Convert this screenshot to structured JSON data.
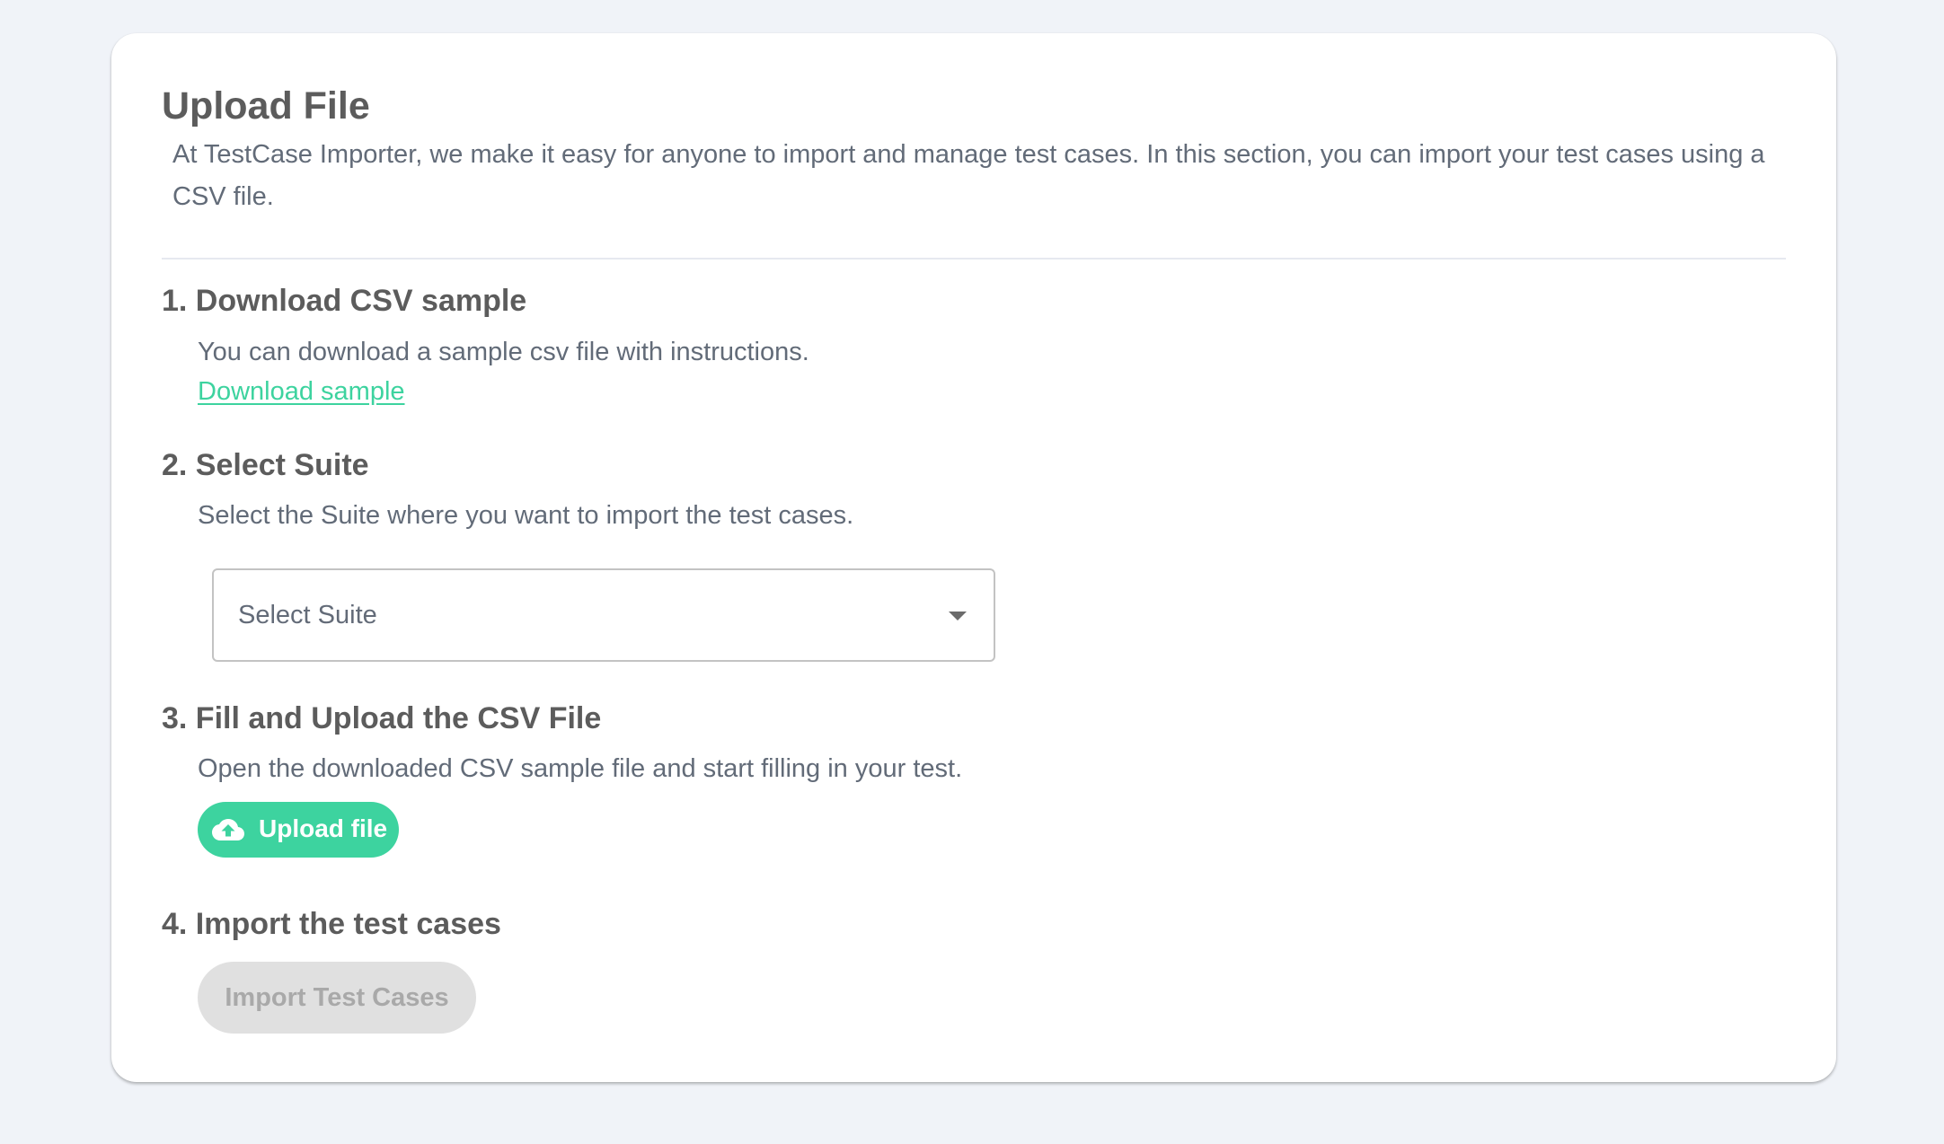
{
  "header": {
    "title": "Upload File",
    "description": "At TestCase Importer, we make it easy for anyone to import and manage test cases. In this section, you can import your test cases using a CSV file."
  },
  "steps": [
    {
      "title": "1. Download CSV sample",
      "description": "You can download a sample csv file with instructions.",
      "link_label": "Download sample"
    },
    {
      "title": "2. Select Suite",
      "description": "Select the Suite where you want to import the test cases.",
      "select_value": "Select Suite"
    },
    {
      "title": "3. Fill and Upload the CSV File",
      "description": "Open the downloaded CSV sample file and start filling in your test.",
      "button_label": "Upload file",
      "button_icon": "cloud-upload-icon"
    },
    {
      "title": "4. Import the test cases",
      "button_label": "Import Test Cases",
      "button_state": "disabled"
    }
  ],
  "colors": {
    "accent": "#3dd39f",
    "background": "#f0f3f8",
    "card": "#ffffff",
    "heading": "#5c5c5c",
    "body_text": "#626b78",
    "disabled_bg": "#e0e0e0",
    "disabled_text": "#a9a9a9"
  }
}
